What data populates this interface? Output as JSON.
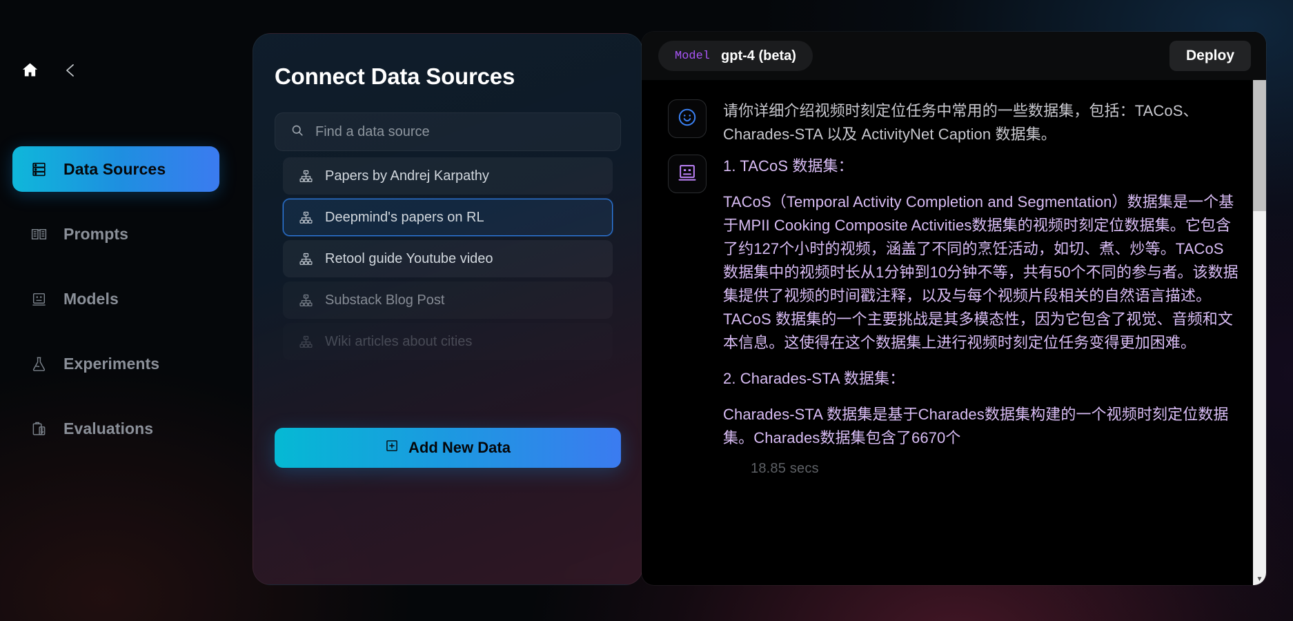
{
  "sidebar": {
    "home_icon": "home-icon",
    "back_icon": "chevron-left-icon",
    "items": [
      {
        "label": "Data Sources",
        "icon": "database-icon",
        "active": true
      },
      {
        "label": "Prompts",
        "icon": "book-icon",
        "active": false
      },
      {
        "label": "Models",
        "icon": "robot-face-icon",
        "active": false
      },
      {
        "label": "Experiments",
        "icon": "flask-icon",
        "active": false
      },
      {
        "label": "Evaluations",
        "icon": "clipboard-icon",
        "active": false
      }
    ]
  },
  "data_sources": {
    "title": "Connect Data Sources",
    "search": {
      "placeholder": "Find a data source",
      "value": "",
      "icon": "search-icon"
    },
    "items": [
      {
        "label": "Papers by Andrej Karpathy",
        "icon": "sitemap-icon",
        "state": "normal"
      },
      {
        "label": "Deepmind's papers on RL",
        "icon": "sitemap-icon",
        "state": "selected"
      },
      {
        "label": "Retool guide Youtube video",
        "icon": "sitemap-icon",
        "state": "normal"
      },
      {
        "label": "Substack Blog Post",
        "icon": "sitemap-icon",
        "state": "dim"
      },
      {
        "label": "Wiki articles about cities",
        "icon": "sitemap-icon",
        "state": "dimmer"
      }
    ],
    "add_button": {
      "label": "Add New Data",
      "icon": "plus-square-icon"
    }
  },
  "chat": {
    "model_badge": {
      "label": "Model",
      "value": "gpt-4 (beta)"
    },
    "deploy_label": "Deploy",
    "messages": [
      {
        "role": "user",
        "avatar_icon": "smiley-face-icon",
        "paragraphs": [
          "请你详细介绍视频时刻定位任务中常用的一些数据集，包括：TACoS、Charades-STA 以及 ActivityNet Caption 数据集。"
        ]
      },
      {
        "role": "assistant",
        "avatar_icon": "robot-face-icon",
        "paragraphs": [
          "1. TACoS 数据集：",
          "TACoS（Temporal Activity Completion and Segmentation）数据集是一个基于MPII Cooking Composite Activities数据集的视频时刻定位数据集。它包含了约127个小时的视频，涵盖了不同的烹饪活动，如切、煮、炒等。TACoS 数据集中的视频时长从1分钟到10分钟不等，共有50个不同的参与者。该数据集提供了视频的时间戳注释，以及与每个视频片段相关的自然语言描述。TACoS 数据集的一个主要挑战是其多模态性，因为它包含了视觉、音频和文本信息。这使得在这个数据集上进行视频时刻定位任务变得更加困难。",
          "2. Charades-STA 数据集：",
          "Charades-STA 数据集是基于Charades数据集构建的一个视频时刻定位数据集。Charades数据集包含了6670个"
        ],
        "timing": "18.85 secs"
      }
    ],
    "scrollbar": {
      "icon": "scrollbar-down-arrow"
    }
  },
  "colors": {
    "accent_cyan": "#05b9d4",
    "accent_blue": "#3b7bf0",
    "assistant_text": "#d9bdf5",
    "model_label": "#a855f7",
    "selected_border": "#2f7fe8"
  }
}
